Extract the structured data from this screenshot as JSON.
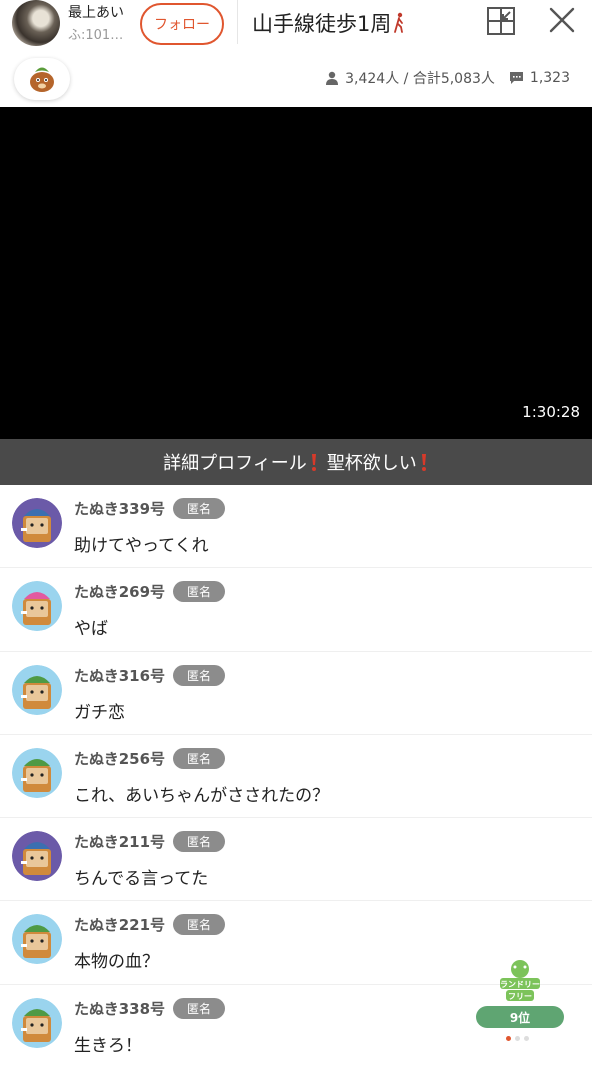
{
  "header": {
    "host_name": "最上あい",
    "host_sub": "ふ:101…",
    "follow_label": "フォロー",
    "title": "山手線徒歩1周",
    "title_emoji_icon": "walking-person-icon",
    "pip_icon": "picture-in-picture-icon",
    "close_icon": "close-icon"
  },
  "stats": {
    "viewers": "3,424人 / 合計5,083人",
    "comments": "1,323",
    "viewer_icon": "person-icon",
    "comment_icon": "comment-bubble-icon"
  },
  "video": {
    "elapsed": "1:30:28"
  },
  "banner": {
    "text_1": "詳細プロフィール",
    "text_2": "聖杯欲しい",
    "mark_icon": "red-exclamation-icon"
  },
  "comments": [
    {
      "user": "たぬき339号",
      "badge": "匿名",
      "text": "助けてやってくれ",
      "avatar_variant": "purple"
    },
    {
      "user": "たぬき269号",
      "badge": "匿名",
      "text": "やば",
      "avatar_variant": "pink"
    },
    {
      "user": "たぬき316号",
      "badge": "匿名",
      "text": "ガチ恋",
      "avatar_variant": "green"
    },
    {
      "user": "たぬき256号",
      "badge": "匿名",
      "text": "これ、あいちゃんがさされたの？",
      "avatar_variant": "green"
    },
    {
      "user": "たぬき211号",
      "badge": "匿名",
      "text": "ちんでる言ってた",
      "avatar_variant": "purple"
    },
    {
      "user": "たぬき221号",
      "badge": "匿名",
      "text": "本物の血？",
      "avatar_variant": "green"
    },
    {
      "user": "たぬき338号",
      "badge": "匿名",
      "text": "生きろ！",
      "avatar_variant": "green"
    }
  ],
  "ranking": {
    "logo_text": "ランドリーフリー",
    "rank": "9位"
  },
  "colors": {
    "accent": "#e0562f",
    "banner_bg": "#4a4a4a",
    "badge_bg": "#8c8c8c",
    "rank_green": "#5fa572"
  }
}
